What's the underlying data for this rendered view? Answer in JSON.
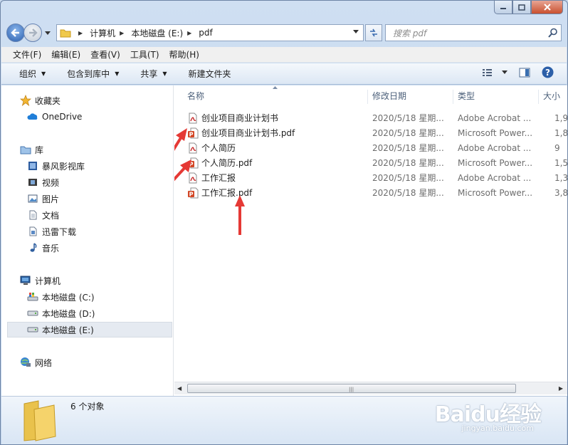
{
  "window": {
    "controls": {
      "minimize": "minimize-icon",
      "maximize": "maximize-icon",
      "close": "close-icon"
    }
  },
  "address": {
    "crumbs": [
      "计算机",
      "本地磁盘 (E:)",
      "pdf"
    ],
    "search_placeholder": "搜索 pdf"
  },
  "menu": {
    "items": [
      "文件(F)",
      "编辑(E)",
      "查看(V)",
      "工具(T)",
      "帮助(H)"
    ]
  },
  "toolbar": {
    "organize": "组织",
    "include_in_library": "包含到库中",
    "share": "共享",
    "new_folder": "新建文件夹"
  },
  "nav": {
    "favorites": "收藏夹",
    "onedrive": "OneDrive",
    "libraries": "库",
    "lib_items": [
      "暴风影视库",
      "视频",
      "图片",
      "文档",
      "迅雷下载",
      "音乐"
    ],
    "computer": "计算机",
    "drives": [
      "本地磁盘 (C:)",
      "本地磁盘 (D:)",
      "本地磁盘 (E:)"
    ],
    "network": "网络"
  },
  "columns": {
    "name": "名称",
    "modified": "修改日期",
    "type": "类型",
    "size": "大小"
  },
  "files": [
    {
      "name": "创业项目商业计划书",
      "date": "2020/5/18 星期...",
      "type": "Adobe Acrobat ...",
      "size": "1,9",
      "icon": "pdf-icon"
    },
    {
      "name": "创业项目商业计划书.pdf",
      "date": "2020/5/18 星期...",
      "type": "Microsoft Power...",
      "size": "1,8",
      "icon": "pptx-icon"
    },
    {
      "name": "个人简历",
      "date": "2020/5/18 星期...",
      "type": "Adobe Acrobat ...",
      "size": "9",
      "icon": "pdf-icon"
    },
    {
      "name": "个人简历.pdf",
      "date": "2020/5/18 星期...",
      "type": "Microsoft Power...",
      "size": "1,5",
      "icon": "pptx-icon"
    },
    {
      "name": "工作汇报",
      "date": "2020/5/18 星期...",
      "type": "Adobe Acrobat ...",
      "size": "1,3",
      "icon": "pdf-icon"
    },
    {
      "name": "工作汇报.pdf",
      "date": "2020/5/18 星期...",
      "type": "Microsoft Power...",
      "size": "3,8",
      "icon": "pptx-icon"
    }
  ],
  "status": {
    "count": "6 个对象"
  },
  "watermark": {
    "brand": "Baidu经验",
    "url": "jingyan.baidu.com"
  },
  "colors": {
    "annotation_arrow": "#e53935",
    "selection": "#e5eaf1"
  }
}
